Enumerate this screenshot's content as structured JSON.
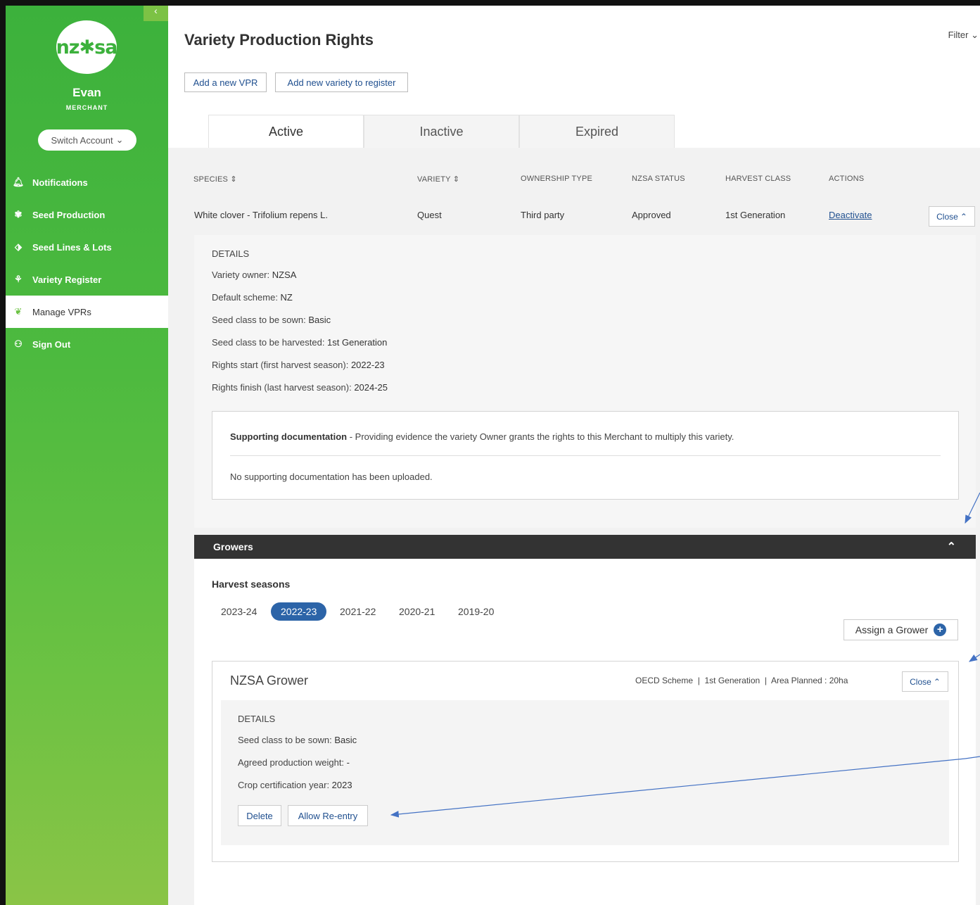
{
  "sidebar": {
    "logo_text": "nz✱sa",
    "collapse_label": "‹",
    "user_name": "Evan",
    "user_role": "MERCHANT",
    "switch_account": "Switch Account",
    "items": [
      {
        "label": "Notifications",
        "icon": "bell-icon"
      },
      {
        "label": "Seed Production",
        "icon": "plant-icon"
      },
      {
        "label": "Seed Lines & Lots",
        "icon": "tag-icon"
      },
      {
        "label": "Variety Register",
        "icon": "sprout-icon"
      },
      {
        "label": "Manage VPRs",
        "icon": "document-plant-icon"
      },
      {
        "label": "Sign Out",
        "icon": "user-icon"
      }
    ]
  },
  "header": {
    "title": "Variety Production Rights",
    "filter": "Filter",
    "add_vpr": "Add a new VPR",
    "add_variety": "Add new variety to register"
  },
  "tabs": [
    "Active",
    "Inactive",
    "Expired"
  ],
  "table": {
    "headers": [
      "SPECIES",
      "VARIETY",
      "OWNERSHIP TYPE",
      "NZSA STATUS",
      "HARVEST CLASS",
      "ACTIONS"
    ],
    "row": {
      "species": "White clover - Trifolium repens L.",
      "variety": "Quest",
      "ownership": "Third party",
      "status": "Approved",
      "harvest_class": "1st Generation",
      "action": "Deactivate",
      "close": "Close"
    }
  },
  "details": {
    "heading": "DETAILS",
    "lines": [
      {
        "label": "Variety owner: ",
        "value": "NZSA"
      },
      {
        "label": "Default scheme: ",
        "value": "NZ"
      },
      {
        "label": "Seed class to be sown: ",
        "value": "Basic"
      },
      {
        "label": "Seed class to be harvested: ",
        "value": "1st Generation"
      },
      {
        "label": "Rights start (first harvest season): ",
        "value": "2022-23"
      },
      {
        "label": "Rights finish (last harvest season): ",
        "value": "2024-25"
      }
    ],
    "doc_title": "Supporting documentation",
    "doc_desc": " - Providing evidence the variety Owner grants the rights to this Merchant to multiply this variety.",
    "doc_empty": "No supporting documentation has been uploaded."
  },
  "growers": {
    "title": "Growers",
    "seasons_label": "Harvest seasons",
    "seasons": [
      "2023-24",
      "2022-23",
      "2021-22",
      "2020-21",
      "2019-20"
    ],
    "selected_season": "2022-23",
    "assign": "Assign a Grower",
    "card": {
      "name": "NZSA Grower",
      "summary": "OECD Scheme  |  1st Generation  |  Area Planned : 20ha",
      "close": "Close",
      "heading": "DETAILS",
      "lines": [
        {
          "label": "Seed class to be sown: ",
          "value": "Basic"
        },
        {
          "label": "Agreed production weight: ",
          "value": "-"
        },
        {
          "label": "Crop certification year: ",
          "value": "2023"
        }
      ],
      "delete": "Delete",
      "reentry": "Allow Re-entry"
    }
  },
  "colors": {
    "brand_green": "#3cb13c",
    "accent_blue": "#2c64a8",
    "link_blue": "#1f4f8f",
    "dark_bar": "#333333"
  }
}
